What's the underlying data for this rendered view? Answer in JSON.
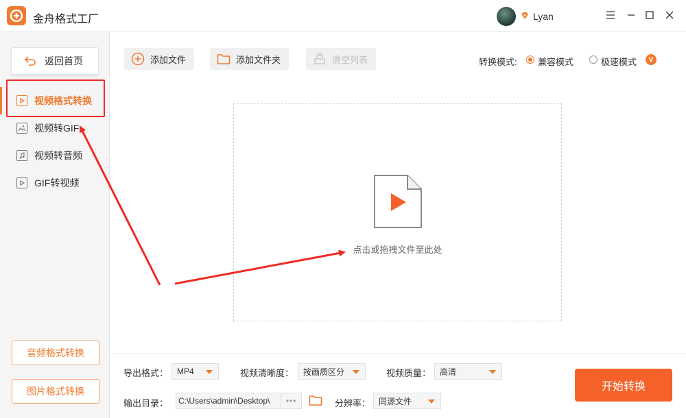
{
  "app": {
    "title": "金舟格式工厂",
    "username": "Lyan",
    "accent": "#f07a2e",
    "start_color": "#f4622a",
    "annotation_color": "#ee2a24"
  },
  "window_controls": [
    "menu-icon",
    "minimize-icon",
    "maximize-icon",
    "close-icon"
  ],
  "sidebar": {
    "home_label": "返回首页",
    "items": [
      {
        "label": "视频格式转换",
        "icon": "video-file-icon",
        "active": true
      },
      {
        "label": "视频转GIF",
        "icon": "image-file-icon",
        "active": false
      },
      {
        "label": "视频转音频",
        "icon": "audio-file-icon",
        "active": false
      },
      {
        "label": "GIF转视频",
        "icon": "video-file-icon",
        "active": false
      }
    ],
    "bottom_buttons": [
      "音频格式转换",
      "图片格式转换"
    ]
  },
  "toolbar": {
    "add_file": "添加文件",
    "add_folder": "添加文件夹",
    "clear_list": "清空列表",
    "mode_label": "转换模式:",
    "mode_options": [
      "兼容模式",
      "极速模式"
    ],
    "mode_selected": "兼容模式",
    "vip_badge": "V"
  },
  "dropzone": {
    "text": "点击或拖拽文件至此处"
  },
  "settings": {
    "format_label": "导出格式：",
    "format_value": "MP4",
    "clarity_label": "视频清晰度：",
    "clarity_value": "按画质区分",
    "quality_label": "视频质量：",
    "quality_value": "高清",
    "output_label": "输出目录：",
    "output_path": "C:\\Users\\admin\\Desktop\\",
    "browse_dots": "•••",
    "resolution_label": "分辨率：",
    "resolution_value": "同源文件"
  },
  "start_button": "开始转换"
}
